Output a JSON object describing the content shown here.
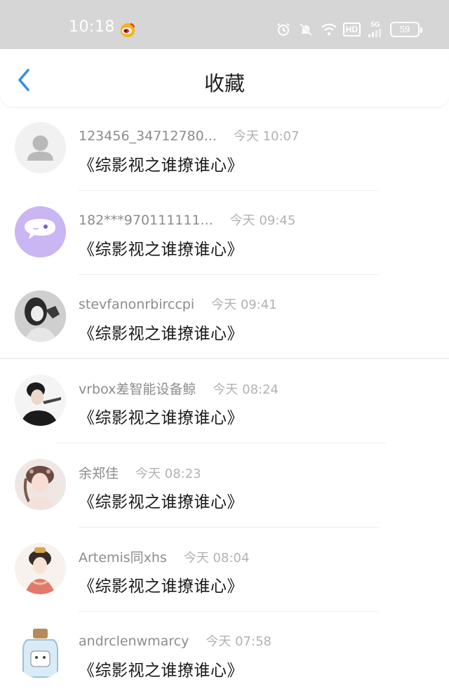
{
  "status_bar": {
    "time": "10:18",
    "battery": "59",
    "network": "5G",
    "hd": "HD",
    "icons": [
      "weibo-icon",
      "alarm-icon",
      "mute-icon",
      "wifi-icon",
      "hd-icon",
      "signal-icon",
      "battery-icon"
    ]
  },
  "nav": {
    "back_icon": "chevron-left-icon",
    "title": "收藏",
    "accent_color": "#2f8fe6"
  },
  "items": [
    {
      "username": "123456_34712780...",
      "time": "今天 10:07",
      "title": "《综影视之谁撩谁心》",
      "avatar": "default-avatar"
    },
    {
      "username": "182***970111111...",
      "time": "今天 09:45",
      "title": "《综影视之谁撩谁心》",
      "avatar": "chat-bubble-avatar"
    },
    {
      "username": "stevfanonrbirccpi",
      "time": "今天 09:41",
      "title": "《综影视之谁撩谁心》",
      "avatar": "photo-avatar"
    },
    {
      "username": "vrbox差智能设备鲸",
      "time": "今天 08:24",
      "title": "《综影视之谁撩谁心》",
      "avatar": "photo-avatar"
    },
    {
      "username": "余郑佳",
      "time": "今天 08:23",
      "title": "《综影视之谁撩谁心》",
      "avatar": "illustration-avatar"
    },
    {
      "username": "Artemis同xhs",
      "time": "今天 08:04",
      "title": "《综影视之谁撩谁心》",
      "avatar": "illustration-avatar"
    },
    {
      "username": "andrclenwmarcy",
      "time": "今天 07:58",
      "title": "《综影视之谁撩谁心》",
      "avatar": "jar-avatar"
    }
  ]
}
